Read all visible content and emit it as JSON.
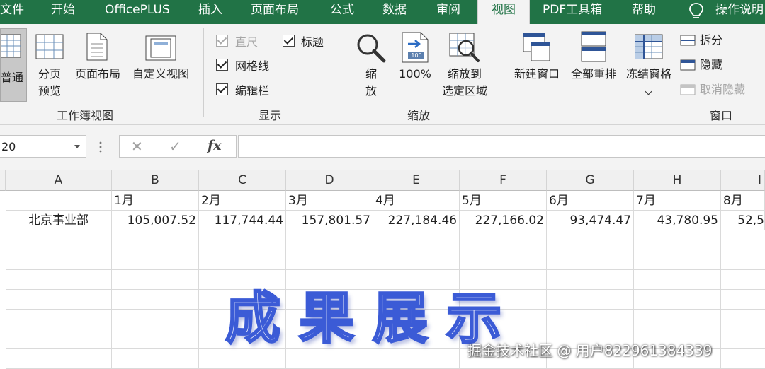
{
  "tabs": [
    {
      "label": "文件"
    },
    {
      "label": "开始"
    },
    {
      "label": "OfficePLUS"
    },
    {
      "label": "插入"
    },
    {
      "label": "页面布局"
    },
    {
      "label": "公式"
    },
    {
      "label": "数据"
    },
    {
      "label": "审阅"
    },
    {
      "label": "视图",
      "active": true
    },
    {
      "label": "PDF工具箱"
    },
    {
      "label": "帮助"
    },
    {
      "label": "操作说明"
    }
  ],
  "ribbon": {
    "workbook_views": {
      "group_label": "工作簿视图",
      "normal": "普通",
      "page_break_line1": "分页",
      "page_break_line2": "预览",
      "page_layout": "页面布局",
      "custom_views": "自定义视图"
    },
    "show": {
      "group_label": "显示",
      "ruler": "直尺",
      "gridlines": "网格线",
      "formula_bar": "编辑栏",
      "headings": "标题"
    },
    "zoom": {
      "group_label": "缩放",
      "zoom_line1": "缩",
      "zoom_line2": "放",
      "zoom_100": "100%",
      "zoom_100_icon_text": "100",
      "zoom_selection_line1": "缩放到",
      "zoom_selection_line2": "选定区域"
    },
    "window": {
      "group_label": "窗口",
      "new_window": "新建窗口",
      "arrange_all": "全部重排",
      "freeze_panes": "冻结窗格",
      "split": "拆分",
      "hide": "隐藏",
      "unhide": "取消隐藏"
    }
  },
  "formula_bar": {
    "name_box": "20",
    "cancel": "✕",
    "enter": "✓",
    "fx": "fx",
    "value": ""
  },
  "sheet": {
    "columns": [
      "A",
      "B",
      "C",
      "D",
      "E",
      "F",
      "G",
      "H",
      "I"
    ],
    "row1": [
      "",
      "1月",
      "2月",
      "3月",
      "4月",
      "5月",
      "6月",
      "7月",
      "8月"
    ],
    "row2": [
      "北京事业部",
      "105,007.52",
      "117,744.44",
      "157,801.57",
      "227,184.46",
      "227,166.02",
      "93,474.47",
      "43,780.95",
      "52,5"
    ]
  },
  "overlay": {
    "title": "成果展示",
    "watermark": "掘金技术社区 @ 用户822961384339"
  },
  "colors": {
    "accent": "#217346",
    "title_stroke": "#3b5bd6"
  }
}
